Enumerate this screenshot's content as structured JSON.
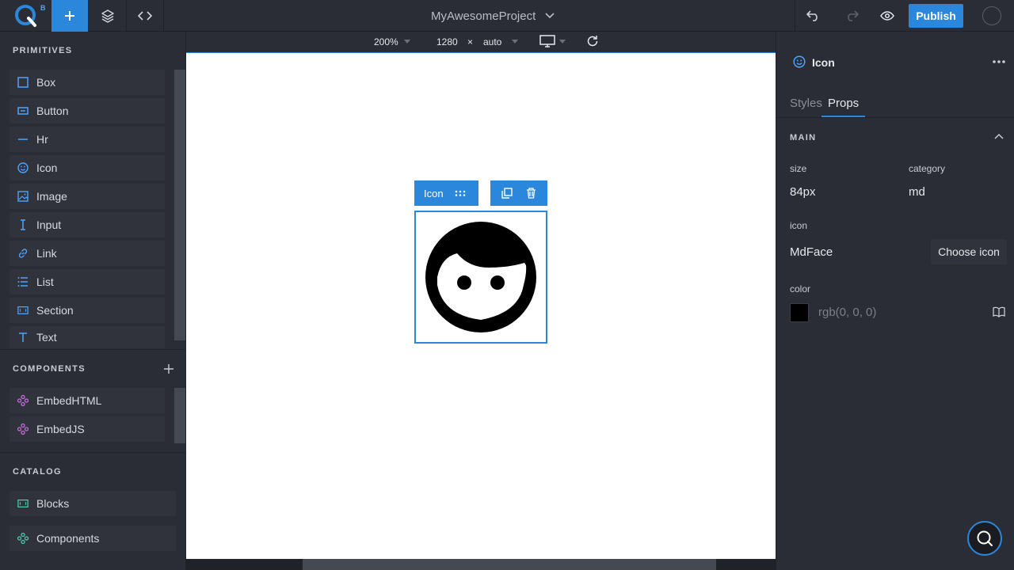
{
  "topbar": {
    "logo_badge": "B",
    "project_name": "MyAwesomeProject",
    "publish_label": "Publish"
  },
  "left": {
    "primitives_title": "PRIMITIVES",
    "primitives": [
      {
        "label": "Box",
        "icon": "square-icon"
      },
      {
        "label": "Button",
        "icon": "button-icon"
      },
      {
        "label": "Hr",
        "icon": "hr-icon"
      },
      {
        "label": "Icon",
        "icon": "smile-icon"
      },
      {
        "label": "Image",
        "icon": "image-icon"
      },
      {
        "label": "Input",
        "icon": "text-cursor-icon"
      },
      {
        "label": "Link",
        "icon": "link-icon"
      },
      {
        "label": "List",
        "icon": "list-icon"
      },
      {
        "label": "Section",
        "icon": "section-icon"
      },
      {
        "label": "Text",
        "icon": "text-icon"
      }
    ],
    "components_title": "COMPONENTS",
    "components": [
      {
        "label": "EmbedHTML",
        "icon": "component-icon"
      },
      {
        "label": "EmbedJS",
        "icon": "component-icon"
      }
    ],
    "catalog_title": "CATALOG",
    "catalog": [
      {
        "label": "Blocks",
        "icon": "blocks-icon"
      },
      {
        "label": "Components",
        "icon": "component-icon"
      }
    ]
  },
  "canvas_bar": {
    "zoom": "200%",
    "width": "1280",
    "times": "×",
    "height": "auto"
  },
  "canvas": {
    "selected_tag": "Icon"
  },
  "right": {
    "header_title": "Icon",
    "tabs": [
      "Styles",
      "Props"
    ],
    "active_tab": "Props",
    "section_title": "MAIN",
    "size_label": "size",
    "size_value": "84px",
    "category_label": "category",
    "category_value": "md",
    "icon_label": "icon",
    "icon_value": "MdFace",
    "choose_icon_label": "Choose icon",
    "color_label": "color",
    "color_value": "rgb(0, 0, 0)"
  },
  "colors": {
    "accent": "#2b87dc",
    "panel": "#2a2d35",
    "component": "#c86bdf",
    "catalog": "#4ec9b0"
  }
}
